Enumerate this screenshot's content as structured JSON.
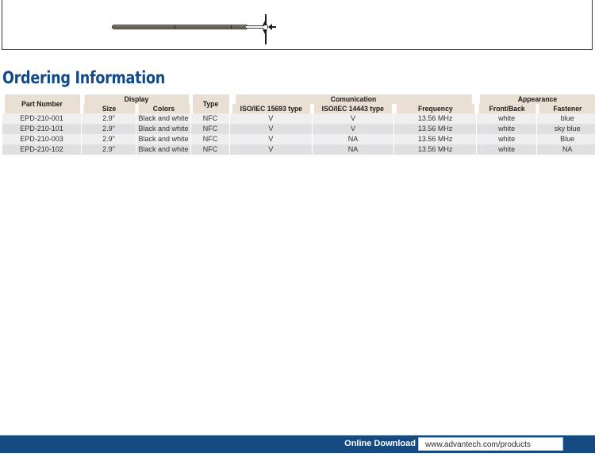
{
  "drawing": {
    "caption": ""
  },
  "section": {
    "title": "Ordering Information"
  },
  "table": {
    "group_headers": {
      "part_number": "Part Number",
      "display": "Display",
      "type_spacer": "",
      "communication": "Comunication",
      "appearance": "Appearance"
    },
    "column_headers": [
      "Part Number",
      "Size",
      "Colors",
      "Type",
      "ISO/IEC 15693 type",
      "ISO/IEC 14443 type",
      "Frequency",
      "Front/Back",
      "Fastener"
    ],
    "rows": [
      {
        "part_number": "EPD-210-001",
        "size": "2.9\"",
        "colors": "Black and white",
        "type": "NFC",
        "iso15693": "V",
        "iso14443": "V",
        "frequency": "13.56 MHz",
        "front_back": "white",
        "fastener": "blue"
      },
      {
        "part_number": "EPD-210-101",
        "size": "2.9\"",
        "colors": "Black and white",
        "type": "NFC",
        "iso15693": "V",
        "iso14443": "V",
        "frequency": "13.56 MHz",
        "front_back": "white",
        "fastener": "sky blue"
      },
      {
        "part_number": "EPD-210-003",
        "size": "2.9\"",
        "colors": "Black and white",
        "type": "NFC",
        "iso15693": "V",
        "iso14443": "NA",
        "frequency": "13.56 MHz",
        "front_back": "white",
        "fastener": "Blue"
      },
      {
        "part_number": "EPD-210-102",
        "size": "2.9\"",
        "colors": "Black and white",
        "type": "NFC",
        "iso15693": "V",
        "iso14443": "NA",
        "frequency": "13.56 MHz",
        "front_back": "white",
        "fastener": "NA"
      }
    ]
  },
  "footer": {
    "label": "Online Download",
    "url": "www.advantech.com/products"
  },
  "colors": {
    "title_blue": "#124a87",
    "footer_blue": "#164a82",
    "header_beige": "#e9dfd3",
    "row_odd": "#efeff0",
    "row_even": "#e0e0e2"
  }
}
